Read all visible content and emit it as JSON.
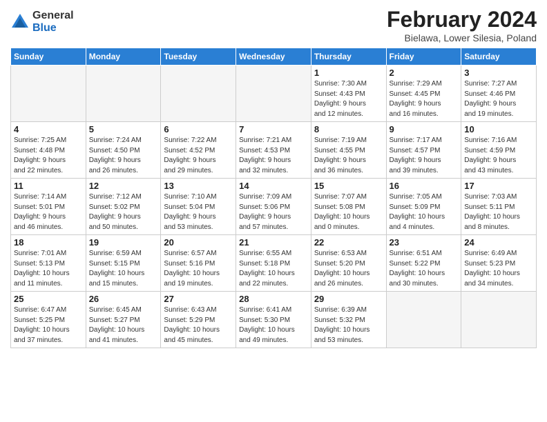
{
  "header": {
    "logo": {
      "general": "General",
      "blue": "Blue"
    },
    "title": "February 2024",
    "location": "Bielawa, Lower Silesia, Poland"
  },
  "calendar": {
    "days": [
      "Sunday",
      "Monday",
      "Tuesday",
      "Wednesday",
      "Thursday",
      "Friday",
      "Saturday"
    ],
    "weeks": [
      [
        {
          "day": "",
          "info": ""
        },
        {
          "day": "",
          "info": ""
        },
        {
          "day": "",
          "info": ""
        },
        {
          "day": "",
          "info": ""
        },
        {
          "day": "1",
          "info": "Sunrise: 7:30 AM\nSunset: 4:43 PM\nDaylight: 9 hours\nand 12 minutes."
        },
        {
          "day": "2",
          "info": "Sunrise: 7:29 AM\nSunset: 4:45 PM\nDaylight: 9 hours\nand 16 minutes."
        },
        {
          "day": "3",
          "info": "Sunrise: 7:27 AM\nSunset: 4:46 PM\nDaylight: 9 hours\nand 19 minutes."
        }
      ],
      [
        {
          "day": "4",
          "info": "Sunrise: 7:25 AM\nSunset: 4:48 PM\nDaylight: 9 hours\nand 22 minutes."
        },
        {
          "day": "5",
          "info": "Sunrise: 7:24 AM\nSunset: 4:50 PM\nDaylight: 9 hours\nand 26 minutes."
        },
        {
          "day": "6",
          "info": "Sunrise: 7:22 AM\nSunset: 4:52 PM\nDaylight: 9 hours\nand 29 minutes."
        },
        {
          "day": "7",
          "info": "Sunrise: 7:21 AM\nSunset: 4:53 PM\nDaylight: 9 hours\nand 32 minutes."
        },
        {
          "day": "8",
          "info": "Sunrise: 7:19 AM\nSunset: 4:55 PM\nDaylight: 9 hours\nand 36 minutes."
        },
        {
          "day": "9",
          "info": "Sunrise: 7:17 AM\nSunset: 4:57 PM\nDaylight: 9 hours\nand 39 minutes."
        },
        {
          "day": "10",
          "info": "Sunrise: 7:16 AM\nSunset: 4:59 PM\nDaylight: 9 hours\nand 43 minutes."
        }
      ],
      [
        {
          "day": "11",
          "info": "Sunrise: 7:14 AM\nSunset: 5:01 PM\nDaylight: 9 hours\nand 46 minutes."
        },
        {
          "day": "12",
          "info": "Sunrise: 7:12 AM\nSunset: 5:02 PM\nDaylight: 9 hours\nand 50 minutes."
        },
        {
          "day": "13",
          "info": "Sunrise: 7:10 AM\nSunset: 5:04 PM\nDaylight: 9 hours\nand 53 minutes."
        },
        {
          "day": "14",
          "info": "Sunrise: 7:09 AM\nSunset: 5:06 PM\nDaylight: 9 hours\nand 57 minutes."
        },
        {
          "day": "15",
          "info": "Sunrise: 7:07 AM\nSunset: 5:08 PM\nDaylight: 10 hours\nand 0 minutes."
        },
        {
          "day": "16",
          "info": "Sunrise: 7:05 AM\nSunset: 5:09 PM\nDaylight: 10 hours\nand 4 minutes."
        },
        {
          "day": "17",
          "info": "Sunrise: 7:03 AM\nSunset: 5:11 PM\nDaylight: 10 hours\nand 8 minutes."
        }
      ],
      [
        {
          "day": "18",
          "info": "Sunrise: 7:01 AM\nSunset: 5:13 PM\nDaylight: 10 hours\nand 11 minutes."
        },
        {
          "day": "19",
          "info": "Sunrise: 6:59 AM\nSunset: 5:15 PM\nDaylight: 10 hours\nand 15 minutes."
        },
        {
          "day": "20",
          "info": "Sunrise: 6:57 AM\nSunset: 5:16 PM\nDaylight: 10 hours\nand 19 minutes."
        },
        {
          "day": "21",
          "info": "Sunrise: 6:55 AM\nSunset: 5:18 PM\nDaylight: 10 hours\nand 22 minutes."
        },
        {
          "day": "22",
          "info": "Sunrise: 6:53 AM\nSunset: 5:20 PM\nDaylight: 10 hours\nand 26 minutes."
        },
        {
          "day": "23",
          "info": "Sunrise: 6:51 AM\nSunset: 5:22 PM\nDaylight: 10 hours\nand 30 minutes."
        },
        {
          "day": "24",
          "info": "Sunrise: 6:49 AM\nSunset: 5:23 PM\nDaylight: 10 hours\nand 34 minutes."
        }
      ],
      [
        {
          "day": "25",
          "info": "Sunrise: 6:47 AM\nSunset: 5:25 PM\nDaylight: 10 hours\nand 37 minutes."
        },
        {
          "day": "26",
          "info": "Sunrise: 6:45 AM\nSunset: 5:27 PM\nDaylight: 10 hours\nand 41 minutes."
        },
        {
          "day": "27",
          "info": "Sunrise: 6:43 AM\nSunset: 5:29 PM\nDaylight: 10 hours\nand 45 minutes."
        },
        {
          "day": "28",
          "info": "Sunrise: 6:41 AM\nSunset: 5:30 PM\nDaylight: 10 hours\nand 49 minutes."
        },
        {
          "day": "29",
          "info": "Sunrise: 6:39 AM\nSunset: 5:32 PM\nDaylight: 10 hours\nand 53 minutes."
        },
        {
          "day": "",
          "info": ""
        },
        {
          "day": "",
          "info": ""
        }
      ]
    ]
  }
}
